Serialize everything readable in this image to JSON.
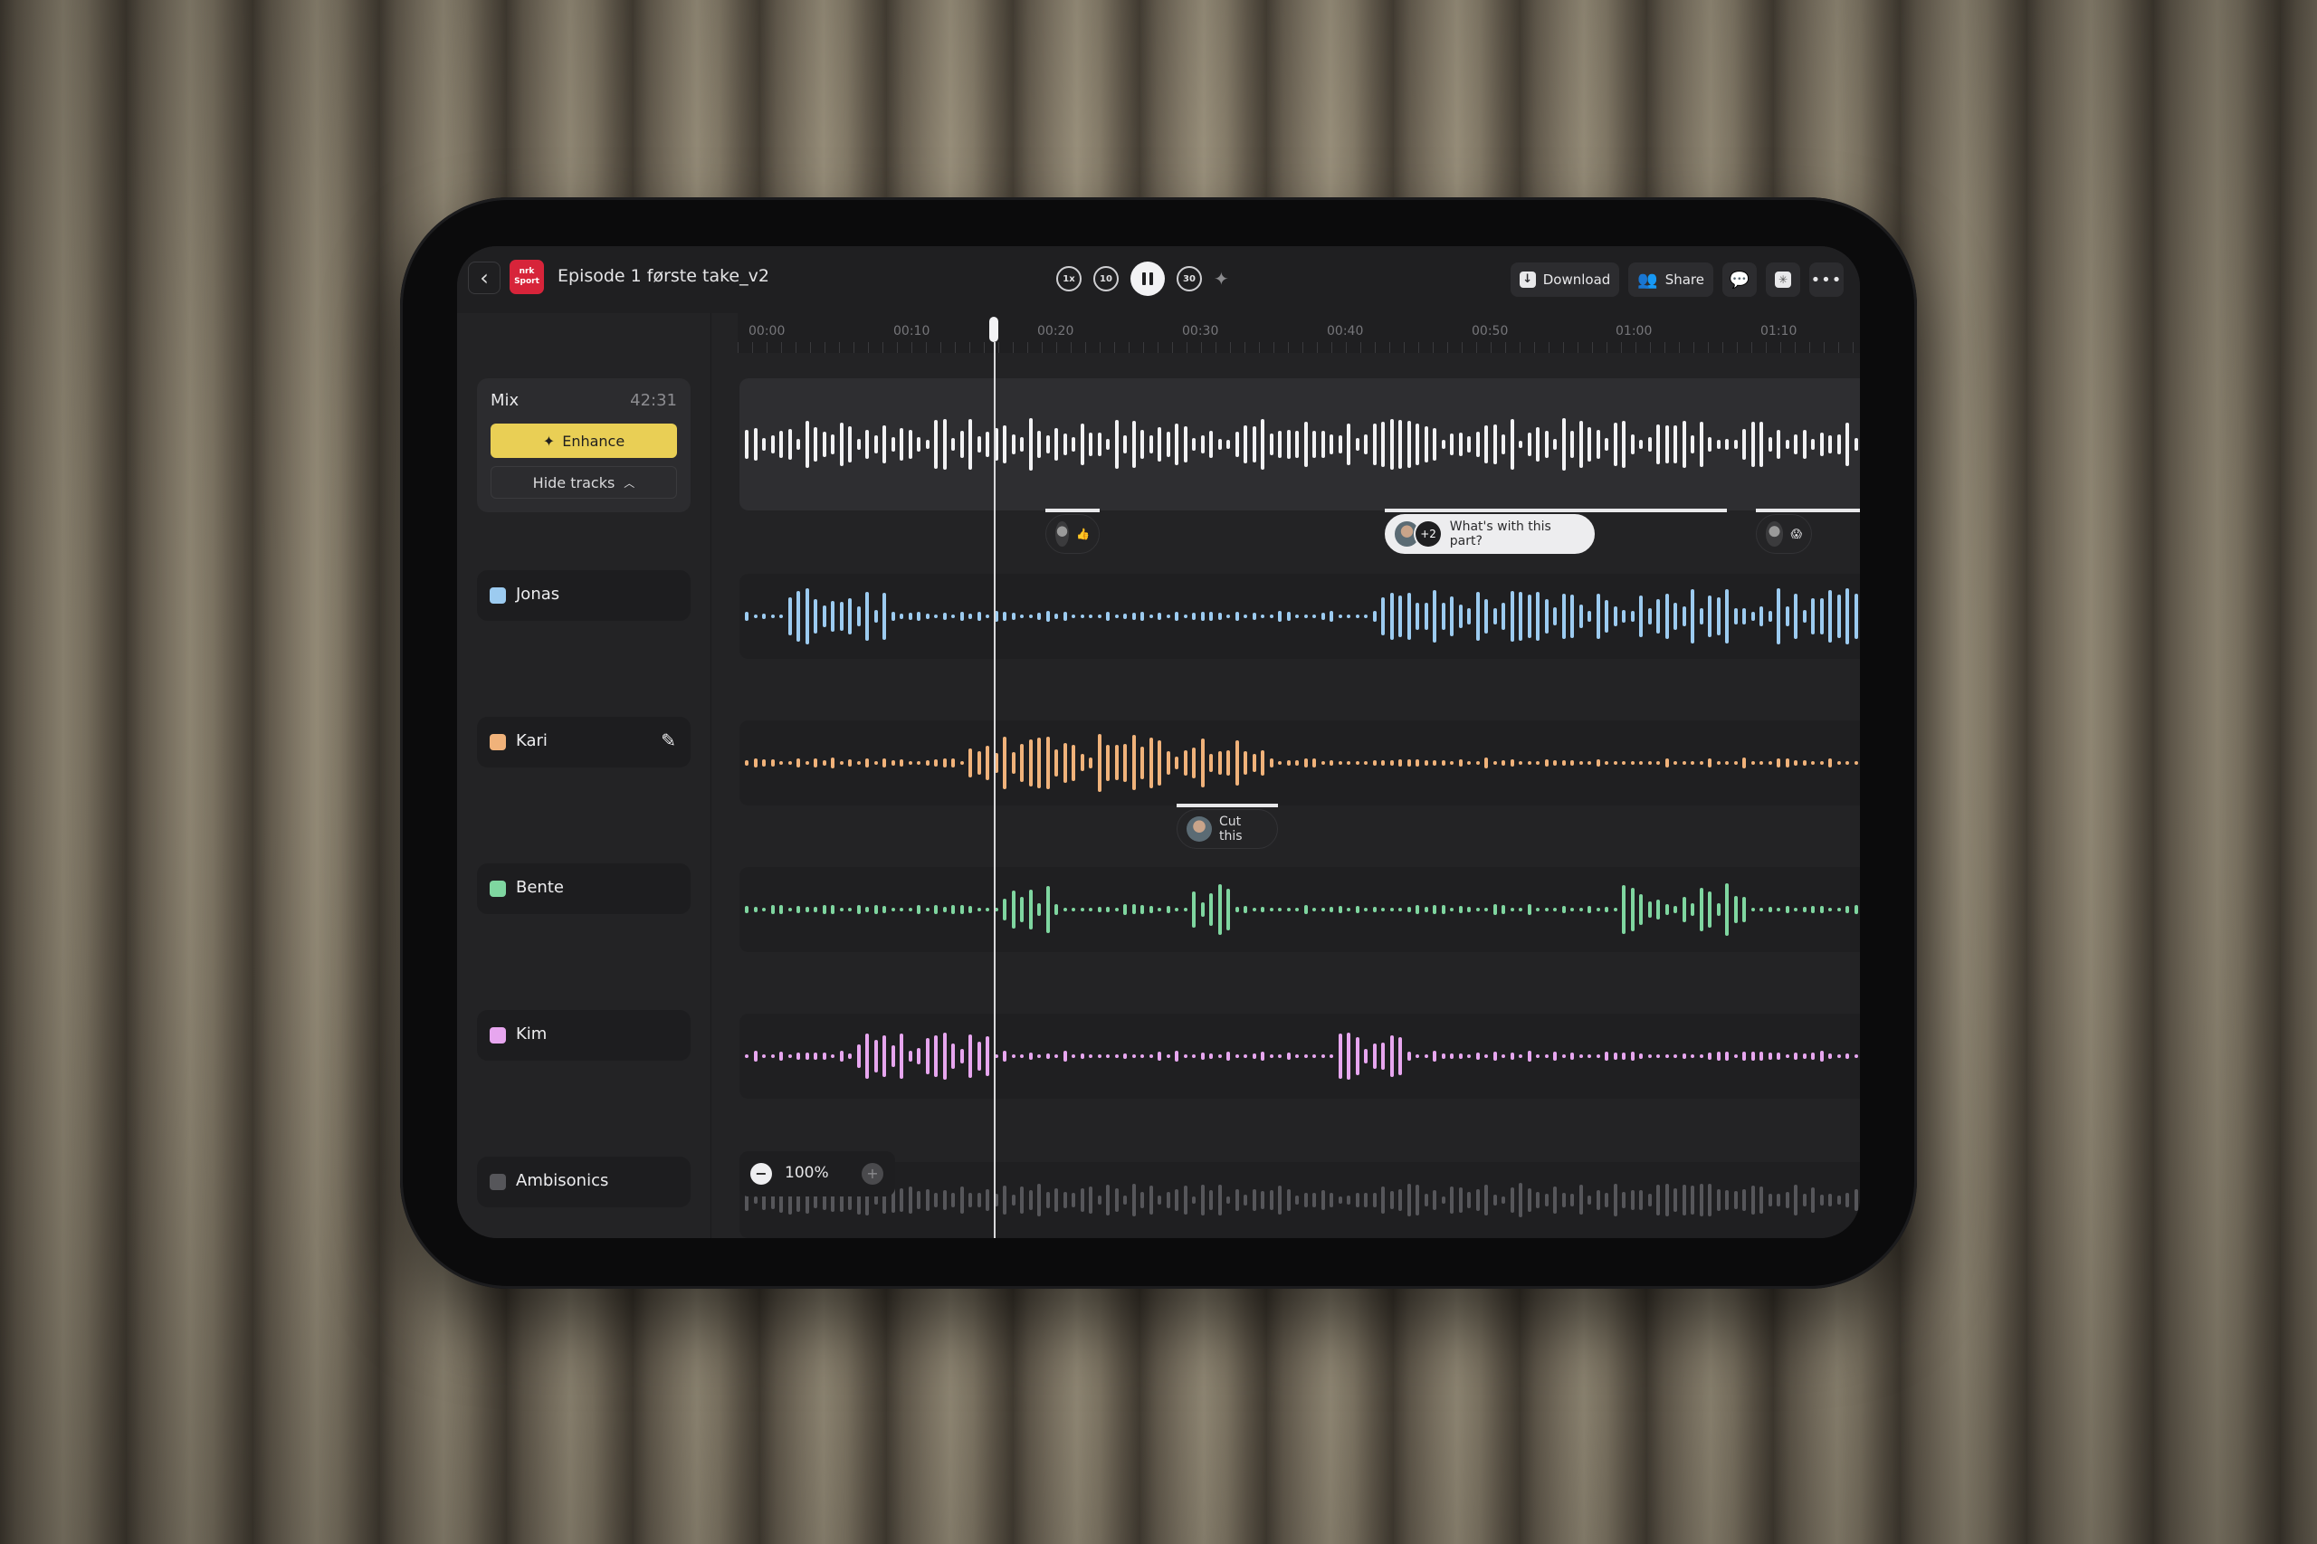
{
  "header": {
    "back_label": "‹",
    "logo_line1": "nrk",
    "logo_line2": "Sport",
    "title": "Episode 1 første take_v2",
    "transport": {
      "speed_label": "1x",
      "rewind_label": "10",
      "forward_label": "30",
      "state": "playing"
    },
    "actions": {
      "download_label": "Download",
      "share_label": "Share"
    }
  },
  "timeline": {
    "ticks": [
      "00:00",
      "00:10",
      "00:20",
      "00:30",
      "00:40",
      "00:50",
      "01:00",
      "01:10"
    ],
    "playhead_time_seconds": 17
  },
  "mix": {
    "label": "Mix",
    "duration": "42:31",
    "enhance_label": "Enhance",
    "hide_tracks_label": "Hide tracks",
    "color": "#f2f2f4"
  },
  "tracks": [
    {
      "name": "Jonas",
      "color": "#9ccbf0"
    },
    {
      "name": "Kari",
      "color": "#f0b27a"
    },
    {
      "name": "Bente",
      "color": "#7fd6a0"
    },
    {
      "name": "Kim",
      "color": "#e7a6ef"
    },
    {
      "name": "Ambisonics",
      "color": "#56565a"
    }
  ],
  "comments": [
    {
      "type": "reaction",
      "emoji": "👍"
    },
    {
      "type": "thread",
      "extra_count": "+2",
      "text": "What's with this part?"
    },
    {
      "type": "reaction",
      "emoji": "😱"
    },
    {
      "type": "note",
      "text": "Cut this"
    }
  ],
  "zoom": {
    "minus_label": "−",
    "value": "100%",
    "plus_label": "+"
  }
}
